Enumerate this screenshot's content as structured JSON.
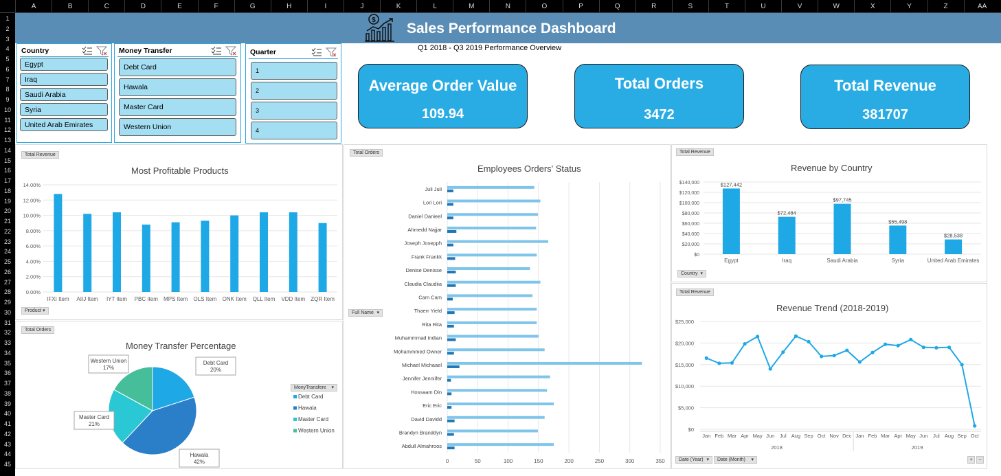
{
  "sheet": {
    "columns": [
      "A",
      "B",
      "C",
      "D",
      "E",
      "F",
      "G",
      "H",
      "I",
      "J",
      "K",
      "L",
      "M",
      "N",
      "O",
      "P",
      "Q",
      "R",
      "S",
      "T",
      "U",
      "V",
      "W",
      "X",
      "Y",
      "Z",
      "AA"
    ],
    "rows": [
      "1",
      "2",
      "3",
      "4",
      "5",
      "6",
      "7",
      "8",
      "9",
      "10",
      "11",
      "12",
      "13",
      "14",
      "15",
      "16",
      "17",
      "18",
      "19",
      "20",
      "21",
      "22",
      "23",
      "24",
      "25",
      "26",
      "27",
      "28",
      "29",
      "30",
      "31",
      "32",
      "33",
      "34",
      "35",
      "36",
      "37",
      "38",
      "39",
      "40",
      "41",
      "42",
      "43",
      "44",
      "45"
    ]
  },
  "header": {
    "title": "Sales Performance Dashboard",
    "subtitle": "Q1 2018 - Q3 2019 Performance Overview",
    "icon": "chart-dollar-icon"
  },
  "slicers": {
    "country": {
      "title": "Country",
      "items": [
        "Egypt",
        "Iraq",
        "Saudi Arabia",
        "Syria",
        "United Arab Emirates"
      ]
    },
    "money_transfer": {
      "title": "Money Transfer",
      "items": [
        "Debt Card",
        "Hawala",
        "Master Card",
        "Western Union"
      ]
    },
    "quarter": {
      "title": "Quarter",
      "items": [
        "1",
        "2",
        "3",
        "4"
      ]
    }
  },
  "kpis": {
    "aov": {
      "title": "Average Order Value",
      "value": "109.94"
    },
    "orders": {
      "title": "Total Orders",
      "value": "3472"
    },
    "revenue": {
      "title": "Total Revenue",
      "value": "381707"
    }
  },
  "colors": {
    "accent": "#29ace4",
    "banner": "#5a8db5",
    "bar": "#1fa8e6",
    "bar_dark": "#1f77b4",
    "bar_light": "#7fc4ea"
  },
  "chart_data": [
    {
      "id": "products",
      "type": "bar",
      "title": "Most Profitable Products",
      "field_tag": "Total Revenue",
      "filter_button": "Product",
      "categories": [
        "IFXI Item",
        "AIIJ Item",
        "IYT Item",
        "PBC Item",
        "MPS Item",
        "OLS Item",
        "ONK Item",
        "QLL Item",
        "VDD Item",
        "ZQR Item"
      ],
      "values": [
        12.8,
        10.2,
        10.4,
        8.8,
        9.1,
        9.3,
        10.0,
        10.4,
        10.4,
        9.0
      ],
      "yticks": [
        "0.00%",
        "2.00%",
        "4.00%",
        "6.00%",
        "8.00%",
        "10.00%",
        "12.00%",
        "14.00%"
      ],
      "ylim": [
        0,
        14
      ],
      "grid": true
    },
    {
      "id": "employees",
      "type": "bar",
      "orientation": "horizontal",
      "title": "Employees Orders' Status",
      "field_tag": "Total Orders",
      "filter_button": "Full Name",
      "categories": [
        "Juli Juli",
        "Lori Lori",
        "Daniel Danieel",
        "Ahmedd Najjar",
        "Joseph Josepph",
        "Frank Frankk",
        "Denise Denisse",
        "Claudia Claudiia",
        "Cam Cam",
        "Thaerr Yield",
        "Rita Rita",
        "Muhammmad Indian",
        "Mohammmed Owner",
        "Michael Michaael",
        "Jennifer Jenniifer",
        "Hossaam Din",
        "Eric Eric",
        "David Davidd",
        "Brandyn Branddyn",
        "Abdull Almahroos"
      ],
      "series": [
        {
          "values": [
            143,
            153,
            149,
            146,
            166,
            147,
            136,
            153,
            140,
            147,
            147,
            150,
            160,
            320,
            169,
            164,
            175,
            160,
            149,
            175
          ]
        },
        {
          "values": [
            10,
            10,
            10,
            15,
            10,
            13,
            14,
            14,
            9,
            12,
            11,
            14,
            11,
            20,
            6,
            7,
            7,
            12,
            11,
            12
          ]
        }
      ],
      "xticks": [
        "0",
        "50",
        "100",
        "150",
        "200",
        "250",
        "300",
        "350"
      ],
      "xlim": [
        0,
        350
      ],
      "grid": true
    },
    {
      "id": "country",
      "type": "bar",
      "title": "Revenue by Country",
      "field_tag": "Total Revenue",
      "filter_button": "Country",
      "categories": [
        "Egypt",
        "Iraq",
        "Saudi Arabia",
        "Syria",
        "United Arab Emirates"
      ],
      "values": [
        127442,
        72484,
        97745,
        55498,
        28538
      ],
      "labels": [
        "$127,442",
        "$72,484",
        "$97,745",
        "$55,498",
        "$28,538"
      ],
      "yticks": [
        "$0",
        "$20,000",
        "$40,000",
        "$60,000",
        "$80,000",
        "$100,000",
        "$120,000",
        "$140,000"
      ],
      "ylim": [
        0,
        140000
      ],
      "grid": true
    },
    {
      "id": "transfer",
      "type": "pie",
      "title": "Money Transfer Percentage",
      "field_tag": "Total Orders",
      "legend_title": "MonyTransfere",
      "categories": [
        "Debt Card",
        "Hawala",
        "Master Card",
        "Western Union"
      ],
      "values": [
        20,
        42,
        21,
        17
      ],
      "labels": [
        "20%",
        "42%",
        "21%",
        "17%"
      ],
      "colors": [
        "#1fa8e6",
        "#2a7fc8",
        "#29c8d4",
        "#46be9a"
      ]
    },
    {
      "id": "trend",
      "type": "line",
      "title": "Revenue Trend (2018-2019)",
      "field_tag": "Total Revenue",
      "filter_buttons": [
        "Date (Year)",
        "Date (Month)"
      ],
      "x": [
        "Jan",
        "Feb",
        "Mar",
        "Apr",
        "May",
        "Jun",
        "Jul",
        "Aug",
        "Sep",
        "Oct",
        "Nov",
        "Dec",
        "Jan",
        "Feb",
        "Mar",
        "Apr",
        "May",
        "Jun",
        "Jul",
        "Aug",
        "Sep",
        "Oct"
      ],
      "groups": [
        "2018",
        "2019"
      ],
      "values": [
        16500,
        15300,
        15400,
        19800,
        21500,
        14000,
        17900,
        21600,
        20300,
        16900,
        17100,
        18300,
        15600,
        17800,
        19700,
        19400,
        20800,
        19000,
        18900,
        19000,
        15000,
        800
      ],
      "yticks": [
        "$0",
        "$5,000",
        "$10,000",
        "$15,000",
        "$20,000",
        "$25,000"
      ],
      "ylim": [
        0,
        25000
      ],
      "grid": true
    }
  ]
}
